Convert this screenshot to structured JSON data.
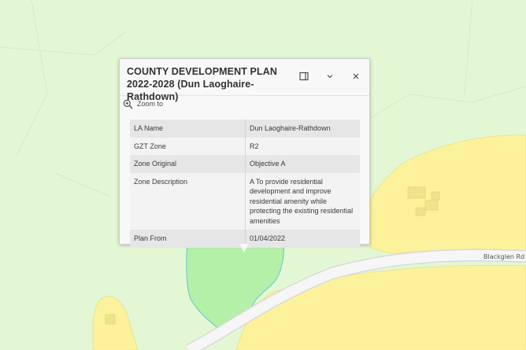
{
  "popup": {
    "title": "COUNTY DEVELOPMENT PLAN 2022-2028 (Dun Laoghaire-Rathdown)",
    "zoom_label": "Zoom to",
    "rows": [
      {
        "key": "LA Name",
        "value": "Dun Laoghaire-Rathdown"
      },
      {
        "key": "GZT Zone",
        "value": "R2"
      },
      {
        "key": "Zone Original",
        "value": "Objective A"
      },
      {
        "key": "Zone Description",
        "value": "A To provide residential development and improve residential amenity while protecting the existing residential amenities"
      },
      {
        "key": "Plan From",
        "value": "01/04/2022"
      }
    ],
    "icons": {
      "dock": "dock-icon",
      "collapse": "chevron-down-icon",
      "close": "close-icon",
      "zoom": "zoom-in-icon"
    }
  },
  "map": {
    "road_label": "Blackglen Rd",
    "colors": {
      "background": "#e3f7d5",
      "residential": "#fbf29b",
      "selected": "#b4f0a8",
      "road": "#f6f6f6"
    }
  }
}
